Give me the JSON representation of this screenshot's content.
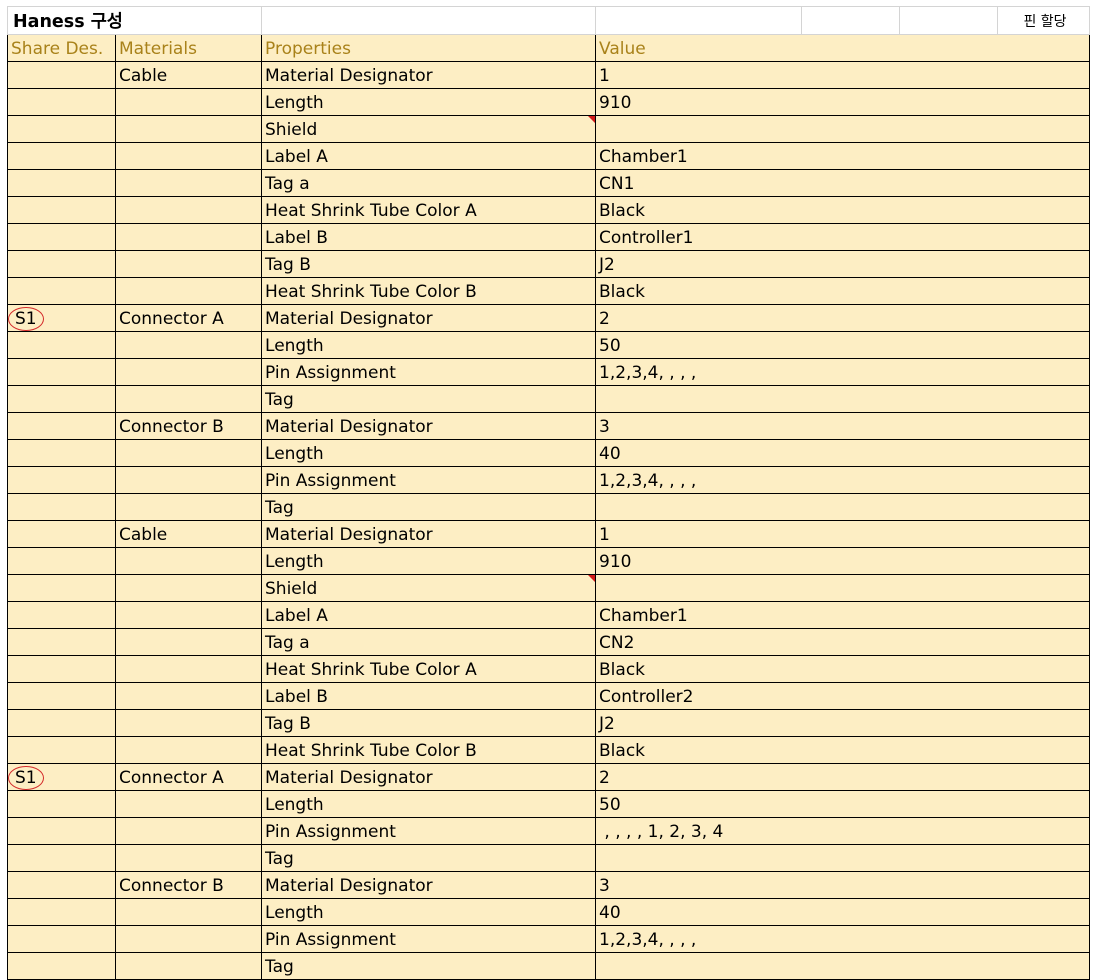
{
  "sheet": {
    "title": "Haness 구성",
    "pin_assign_label": "핀 할당",
    "headers": {
      "share": "Share Des.",
      "materials": "Materials",
      "properties": "Properties",
      "value": "Value"
    },
    "rows": [
      {
        "share": "",
        "material": "Cable",
        "property": "Material Designator",
        "value": "1"
      },
      {
        "share": "",
        "material": "",
        "property": "Length",
        "value": "910"
      },
      {
        "share": "",
        "material": "",
        "property": "Shield",
        "value": "",
        "comment_marker": true
      },
      {
        "share": "",
        "material": "",
        "property": "Label A",
        "value": "Chamber1"
      },
      {
        "share": "",
        "material": "",
        "property": "Tag a",
        "value": "CN1"
      },
      {
        "share": "",
        "material": "",
        "property": "Heat Shrink Tube Color A",
        "value": "Black"
      },
      {
        "share": "",
        "material": "",
        "property": "Label B",
        "value": "Controller1"
      },
      {
        "share": "",
        "material": "",
        "property": "Tag B",
        "value": "J2"
      },
      {
        "share": "",
        "material": "",
        "property": "Heat Shrink Tube Color B",
        "value": "Black"
      },
      {
        "share": "S1",
        "material": "Connector A",
        "property": "Material Designator",
        "value": "2"
      },
      {
        "share": "",
        "material": "",
        "property": "Length",
        "value": "50"
      },
      {
        "share": "",
        "material": "",
        "property": "Pin Assignment",
        "value": "1,2,3,4, , , ,"
      },
      {
        "share": "",
        "material": "",
        "property": "Tag",
        "value": ""
      },
      {
        "share": "",
        "material": "Connector B",
        "property": "Material Designator",
        "value": "3"
      },
      {
        "share": "",
        "material": "",
        "property": "Length",
        "value": "40"
      },
      {
        "share": "",
        "material": "",
        "property": "Pin Assignment",
        "value": "1,2,3,4, , , ,"
      },
      {
        "share": "",
        "material": "",
        "property": "Tag",
        "value": ""
      },
      {
        "share": "",
        "material": "Cable",
        "property": "Material Designator",
        "value": "1"
      },
      {
        "share": "",
        "material": "",
        "property": "Length",
        "value": "910"
      },
      {
        "share": "",
        "material": "",
        "property": "Shield",
        "value": "",
        "comment_marker": true
      },
      {
        "share": "",
        "material": "",
        "property": "Label A",
        "value": "Chamber1"
      },
      {
        "share": "",
        "material": "",
        "property": "Tag a",
        "value": "CN2"
      },
      {
        "share": "",
        "material": "",
        "property": "Heat Shrink Tube Color A",
        "value": "Black"
      },
      {
        "share": "",
        "material": "",
        "property": "Label B",
        "value": "Controller2"
      },
      {
        "share": "",
        "material": "",
        "property": "Tag B",
        "value": "J2"
      },
      {
        "share": "",
        "material": "",
        "property": "Heat Shrink Tube Color B",
        "value": "Black"
      },
      {
        "share": "S1",
        "material": "Connector A",
        "property": "Material Designator",
        "value": "2"
      },
      {
        "share": "",
        "material": "",
        "property": "Length",
        "value": "50"
      },
      {
        "share": "",
        "material": "",
        "property": "Pin Assignment",
        "value": " , , , , 1, 2, 3, 4"
      },
      {
        "share": "",
        "material": "",
        "property": "Tag",
        "value": ""
      },
      {
        "share": "",
        "material": "Connector B",
        "property": "Material Designator",
        "value": "3"
      },
      {
        "share": "",
        "material": "",
        "property": "Length",
        "value": "40"
      },
      {
        "share": "",
        "material": "",
        "property": "Pin Assignment",
        "value": "1,2,3,4, , , ,"
      },
      {
        "share": "",
        "material": "",
        "property": "Tag",
        "value": ""
      }
    ]
  },
  "colors": {
    "cell_fill": "#fdeec4",
    "header_text": "#a9821a",
    "circle": "#d42a2a",
    "comment_marker": "#d21919"
  }
}
